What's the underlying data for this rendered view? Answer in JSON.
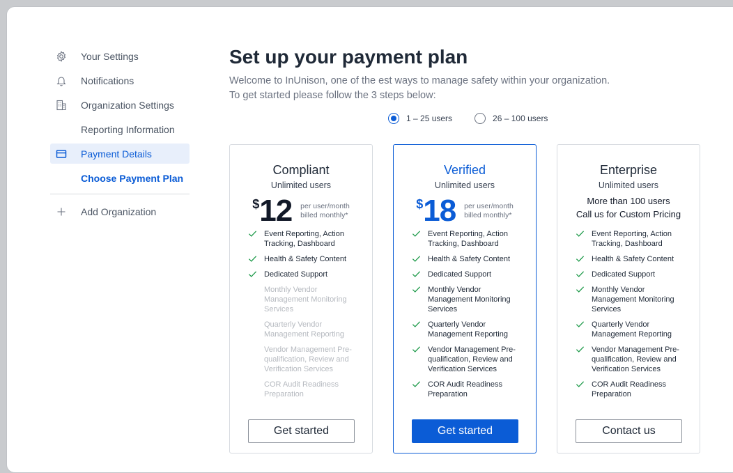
{
  "sidebar": {
    "items": [
      {
        "label": "Your Settings",
        "icon": "gear-icon"
      },
      {
        "label": "Notifications",
        "icon": "bell-icon"
      },
      {
        "label": "Organization Settings",
        "icon": "building-icon"
      },
      {
        "label": "Reporting Information"
      },
      {
        "label": "Payment Details",
        "icon": "credit-card-icon"
      },
      {
        "label": "Choose Payment Plan"
      },
      {
        "label": "Add Organization",
        "icon": "plus-icon"
      }
    ]
  },
  "main": {
    "title": "Set up your payment plan",
    "intro_line1": "Welcome to InUnison, one of the est ways to manage safety within your organization.",
    "intro_line2": "To get started please follow the 3 steps below:",
    "user_options": [
      {
        "label": "1 – 25 users",
        "selected": true
      },
      {
        "label": "26 – 100 users",
        "selected": false
      }
    ]
  },
  "plans": [
    {
      "name": "Compliant",
      "subtitle": "Unlimited users",
      "currency": "$",
      "price": "12",
      "price_note1": "per user/month",
      "price_note2": "billed monthly*",
      "features": [
        {
          "text": "Event Reporting, Action Tracking, Dashboard",
          "included": true
        },
        {
          "text": "Health & Safety Content",
          "included": true
        },
        {
          "text": "Dedicated Support",
          "included": true
        },
        {
          "text": "Monthly Vendor Management Monitoring Services",
          "included": false
        },
        {
          "text": "Quarterly Vendor Management Reporting",
          "included": false
        },
        {
          "text": "Vendor Management Pre-qualification, Review and Verification Services",
          "included": false
        },
        {
          "text": "COR Audit Readiness Preparation",
          "included": false
        }
      ],
      "cta": "Get started"
    },
    {
      "name": "Verified",
      "subtitle": "Unlimited users",
      "currency": "$",
      "price": "18",
      "price_note1": "per user/month",
      "price_note2": "billed monthly*",
      "features": [
        {
          "text": "Event Reporting, Action Tracking, Dashboard",
          "included": true
        },
        {
          "text": "Health & Safety Content",
          "included": true
        },
        {
          "text": "Dedicated Support",
          "included": true
        },
        {
          "text": "Monthly Vendor Management Monitoring Services",
          "included": true
        },
        {
          "text": "Quarterly Vendor Management Reporting",
          "included": true
        },
        {
          "text": "Vendor Management Pre-qualification, Review and Verification Services",
          "included": true
        },
        {
          "text": "COR Audit Readiness Preparation",
          "included": true
        }
      ],
      "cta": "Get started"
    },
    {
      "name": "Enterprise",
      "subtitle": "Unlimited users",
      "custom_line1": "More than 100 users",
      "custom_line2": "Call us for Custom Pricing",
      "features": [
        {
          "text": "Event Reporting, Action Tracking, Dashboard",
          "included": true
        },
        {
          "text": "Health & Safety Content",
          "included": true
        },
        {
          "text": "Dedicated Support",
          "included": true
        },
        {
          "text": "Monthly Vendor Management Monitoring Services",
          "included": true
        },
        {
          "text": "Quarterly Vendor Management Reporting",
          "included": true
        },
        {
          "text": "Vendor Management Pre-qualification, Review and Verification Services",
          "included": true
        },
        {
          "text": "COR Audit Readiness Preparation",
          "included": true
        }
      ],
      "cta": "Contact us"
    }
  ],
  "colors": {
    "accent": "#0b5cd6",
    "check": "#1e9a4a",
    "active_bg": "#e8effb",
    "muted_text": "#b5b9bf"
  }
}
